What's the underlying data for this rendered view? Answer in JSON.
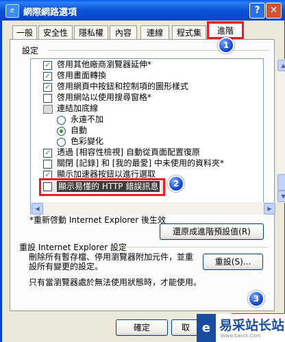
{
  "window": {
    "title": "網際網路選項",
    "help_glyph": "?",
    "close_glyph": "✕",
    "icon_glyph": "e"
  },
  "tabs": [
    {
      "label": "一般"
    },
    {
      "label": "安全性"
    },
    {
      "label": "隱私權"
    },
    {
      "label": "內容"
    },
    {
      "label": "連線"
    },
    {
      "label": "程式集"
    },
    {
      "label": "進階",
      "active": true
    }
  ],
  "settings": {
    "group_title": "設定",
    "items": [
      {
        "type": "checkbox",
        "checked": true,
        "label": "啓用其他廠商瀏覽器延伸*"
      },
      {
        "type": "checkbox",
        "checked": true,
        "label": "啓用畫面轉換"
      },
      {
        "type": "checkbox",
        "checked": true,
        "label": "啓用網頁中按鈕和控制項的圖形樣式"
      },
      {
        "type": "checkbox",
        "checked": false,
        "label": "啓用網站以使用搜尋窗格*"
      },
      {
        "type": "category",
        "label": "連結加底線"
      },
      {
        "type": "radio",
        "checked": false,
        "label": "永遠不加"
      },
      {
        "type": "radio",
        "checked": true,
        "label": "自動"
      },
      {
        "type": "radio",
        "checked": false,
        "label": "色彩變化"
      },
      {
        "type": "checkbox",
        "checked": true,
        "label": "透過 [相容性檢視] 自動從頁面配置復原"
      },
      {
        "type": "checkbox",
        "checked": false,
        "label": "關閉 [記錄] 和 [我的最愛] 中未使用的資料夾*"
      },
      {
        "type": "checkbox",
        "checked": true,
        "label": "顯示加速器按鈕以進行選取"
      },
      {
        "type": "checkbox",
        "checked": false,
        "label": "顯示易懂的 HTTP 錯誤訊息"
      }
    ],
    "note": "*重新啓動 Internet Explorer 後生效",
    "restore_label": "還原成進階預設值(R)"
  },
  "reset": {
    "title": "重設 Internet Explorer 設定",
    "description": "刪除所有暫存檔、停用瀏覽器附加元件，並重設所有變更的設定。",
    "button_label": "重設(S)...",
    "note": "只有當瀏覽器處於無法使用狀態時，才能使用。"
  },
  "footer": {
    "ok_label": "確定",
    "cancel_label": "取"
  },
  "markers": [
    "1",
    "2",
    "3"
  ],
  "watermark": {
    "text": "易采站长站",
    "url": "Www.Easck.Com",
    "logo_glyph": "e"
  }
}
